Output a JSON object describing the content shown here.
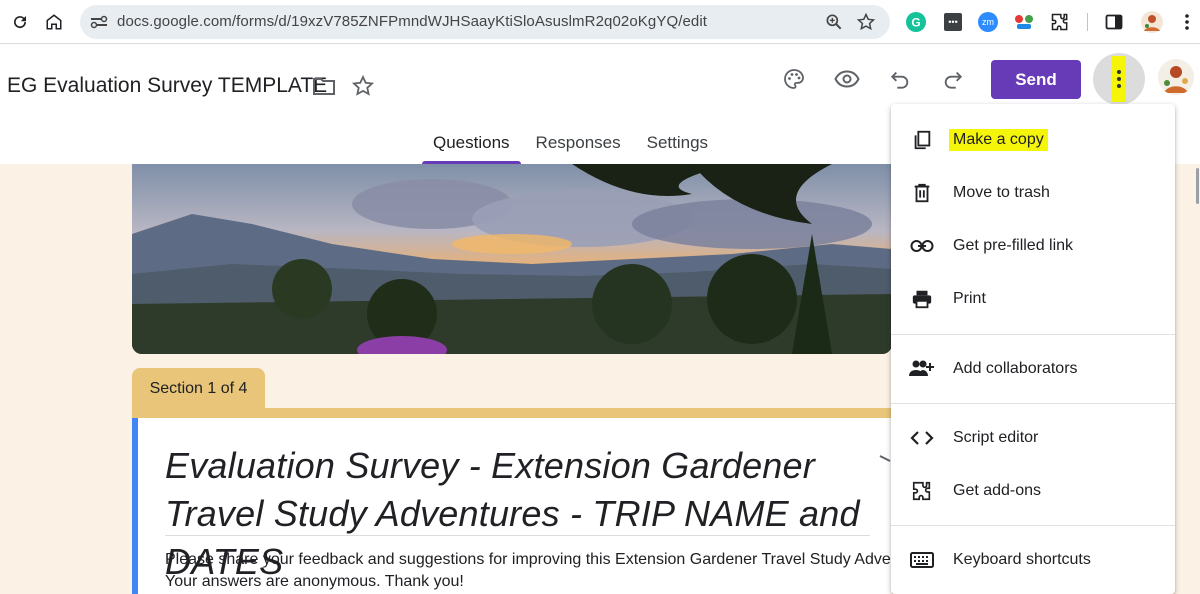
{
  "browser": {
    "url": "docs.google.com/forms/d/19xzV785ZNFPmndWJHSaayKtiSloAsuslmR2q02oKgYQ/edit",
    "icons": [
      "reload-icon",
      "home-icon",
      "site-info-icon",
      "zoom-icon",
      "bookmark-star-icon",
      "grammarly-extension-icon",
      "extension-icon",
      "zoom-extension-icon",
      "extension-icon",
      "extensions-puzzle-icon",
      "side-panel-icon",
      "profile-avatar",
      "chrome-menu-icon"
    ],
    "zoom_ext_label": "zm",
    "dots_ext_label": "•••"
  },
  "header": {
    "doc_title": "EG Evaluation Survey TEMPLATE",
    "send_label": "Send",
    "accent_color": "#673ab7",
    "highlight_color": "#f5f50a"
  },
  "tabs": [
    {
      "label": "Questions",
      "active": true
    },
    {
      "label": "Responses",
      "active": false
    },
    {
      "label": "Settings",
      "active": false
    }
  ],
  "form": {
    "section_label": "Section 1 of 4",
    "title": "Evaluation Survey - Extension Gardener Travel Study Adventures - TRIP NAME and DATES",
    "description_line1": "Please share your feedback and suggestions for improving this Extension Gardener Travel Study Adventure",
    "description_line2": "Your answers are anonymous. Thank you!",
    "theme_color": "#e8c579",
    "background_color": "#fbf1e5"
  },
  "menu": {
    "items": [
      {
        "label": "Make a copy",
        "icon": "copy-icon",
        "highlighted": true
      },
      {
        "label": "Move to trash",
        "icon": "trash-icon",
        "highlighted": false
      },
      {
        "label": "Get pre-filled link",
        "icon": "link-icon",
        "highlighted": false
      },
      {
        "label": "Print",
        "icon": "print-icon",
        "highlighted": false
      },
      {
        "label": "Add collaborators",
        "icon": "add-people-icon",
        "highlighted": false
      },
      {
        "label": "Script editor",
        "icon": "code-icon",
        "highlighted": false
      },
      {
        "label": "Get add-ons",
        "icon": "puzzle-icon",
        "highlighted": false
      },
      {
        "label": "Keyboard shortcuts",
        "icon": "keyboard-icon",
        "highlighted": false
      }
    ]
  }
}
